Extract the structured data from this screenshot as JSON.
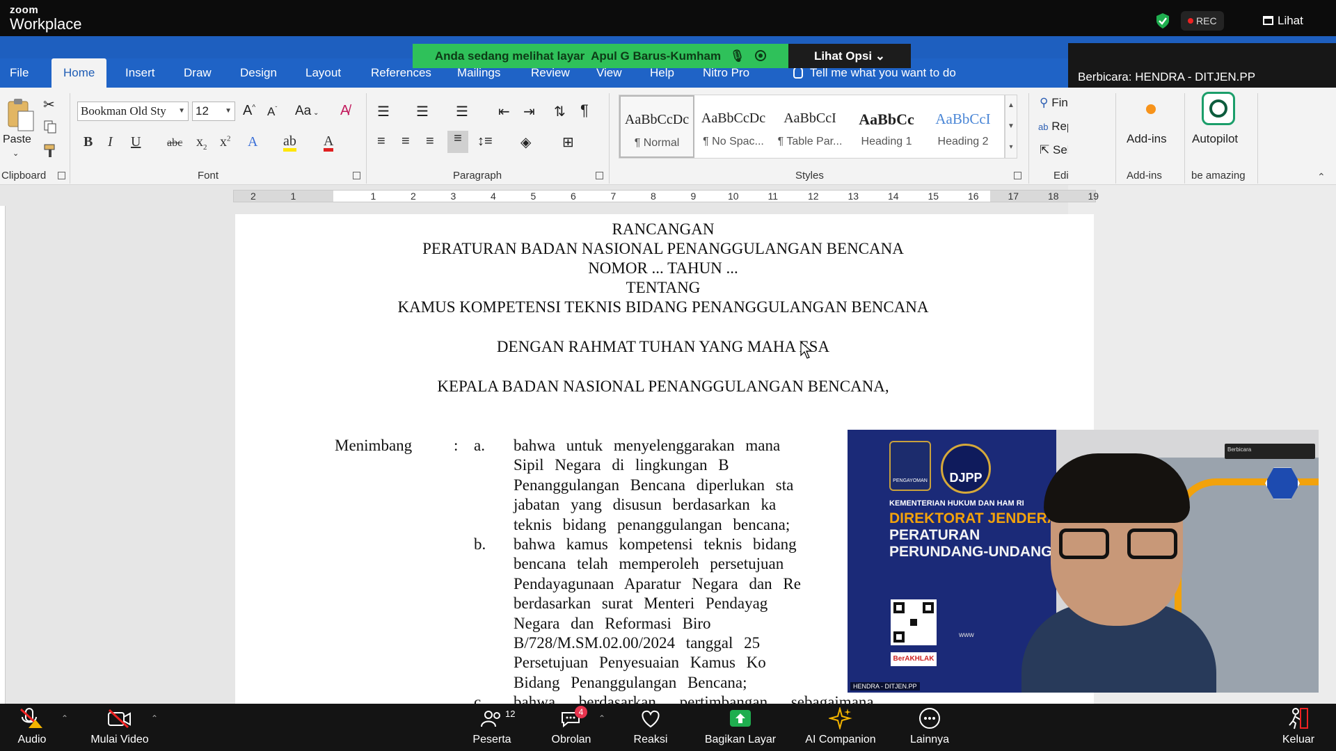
{
  "zoom": {
    "brand_top": "zoom",
    "brand_bottom": "Workplace",
    "rec_label": "REC",
    "view_label": "Lihat",
    "share_banner": "Anda sedang melihat layar",
    "sharer_name": "Apul G Barus-Kumham",
    "view_options": "Lihat Opsi",
    "speaker": "Berbicara: HENDRA - DITJEN.PP",
    "participants_count": "12",
    "chat_badge": "4",
    "bottom": {
      "audio": "Audio",
      "video": "Mulai Video",
      "participants": "Peserta",
      "chat": "Obrolan",
      "reactions": "Reaksi",
      "share": "Bagikan Layar",
      "ai": "AI Companion",
      "more": "Lainnya",
      "leave": "Keluar"
    }
  },
  "word": {
    "tabs": [
      "File",
      "Home",
      "Insert",
      "Draw",
      "Design",
      "Layout",
      "References",
      "Mailings",
      "Review",
      "View",
      "Help",
      "Nitro Pro"
    ],
    "tell_me": "Tell me what you want to do",
    "clipboard": {
      "paste": "Paste",
      "label": "Clipboard"
    },
    "font": {
      "name": "Bookman Old Sty",
      "size": "12",
      "label": "Font",
      "case": "Aa"
    },
    "paragraph": {
      "label": "Paragraph"
    },
    "styles": {
      "label": "Styles",
      "items": [
        {
          "preview": "AaBbCcDc",
          "name": "¶ Normal"
        },
        {
          "preview": "AaBbCcDc",
          "name": "¶ No Spac..."
        },
        {
          "preview": "AaBbCcI",
          "name": "¶ Table Par..."
        },
        {
          "preview": "AaBbCc",
          "name": "Heading 1"
        },
        {
          "preview": "AaBbCcI",
          "name": "Heading 2"
        }
      ]
    },
    "editing": {
      "find": "Find",
      "replace": "Replace",
      "select": "Select",
      "label": "Editing"
    },
    "addins": {
      "button": "Add-ins",
      "label": "Add-ins"
    },
    "autopilot": {
      "button": "Autopilot",
      "label": "be amazing"
    },
    "ruler_left": [
      "2",
      "1"
    ],
    "ruler_right": [
      "1",
      "2",
      "3",
      "4",
      "5",
      "6",
      "7",
      "8",
      "9",
      "10",
      "11",
      "12",
      "13",
      "14",
      "15",
      "16",
      "17",
      "18",
      "19"
    ]
  },
  "document": {
    "title1": "RANCANGAN",
    "title2": "PERATURAN BADAN NASIONAL PENANGGULANGAN BENCANA",
    "title3": "NOMOR ... TAHUN ...",
    "title4": "TENTANG",
    "title5": "KAMUS KOMPETENSI TEKNIS BIDANG PENANGGULANGAN BENCANA",
    "blessing": "DENGAN RAHMAT TUHAN YANG MAHA ESA",
    "head": "KEPALA BADAN NASIONAL PENANGGULANGAN BENCANA,",
    "menimbang": "Menimbang",
    "colon": ":",
    "a_marker": "a.",
    "b_marker": "b.",
    "c_marker": "c.",
    "a_lines": [
      "bahwa untuk menyelenggarakan mana",
      "Sipil Negara di lingkungan B",
      "Penanggulangan Bencana diperlukan sta",
      "jabatan yang disusun berdasarkan ka",
      "teknis bidang penanggulangan bencana;"
    ],
    "b_lines": [
      "bahwa kamus kompetensi teknis bidang",
      "bencana telah memperoleh persetujuan",
      "Pendayagunaan Aparatur Negara dan Re",
      "berdasarkan surat Menteri Pendayag",
      "Negara dan Reformasi Biro",
      "B/728/M.SM.02.00/2024 tanggal 25",
      "Persetujuan Penyesuaian Kamus Ko",
      "Bidang Penanggulangan Bencana;"
    ],
    "c_line": "bahwa berdasarkan pertimbangan sebagaimana"
  },
  "video": {
    "ministry": "KEMENTERIAN HUKUM DAN HAM RI",
    "dir1": "DIREKTORAT JENDERAL",
    "dir2": "PERATURAN",
    "dir3": "PERUNDANG-UNDANGA",
    "djpp": "DJPP",
    "emblem_label": "PENGAYOMAN",
    "berakhlak": "BerAKHLAK",
    "www": "www",
    "name_tag": "HENDRA - DITJEN.PP",
    "speaking_tag": "Berbicara"
  },
  "colors": {
    "word_blue": "#1f63c6",
    "zoom_green": "#2fc15a",
    "ditjen_navy": "#1b2a78",
    "ditjen_orange": "#f2a20c"
  }
}
